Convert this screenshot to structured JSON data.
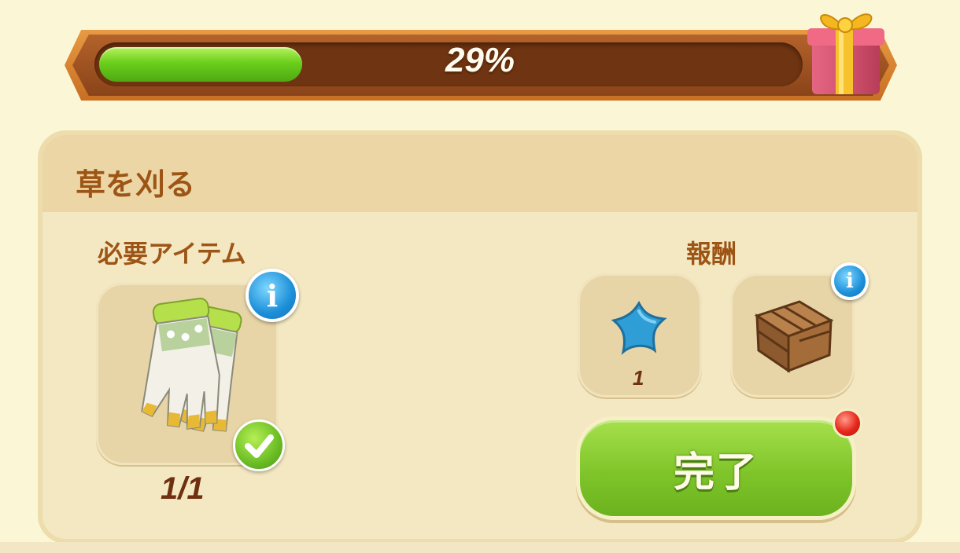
{
  "progress": {
    "percent_label": "29%",
    "fill_fraction": 0.29
  },
  "quest": {
    "title": "草を刈る",
    "required_label": "必要アイテム",
    "reward_label": "報酬",
    "required_item": {
      "icon": "gardening-gloves-icon",
      "count_label": "1/1",
      "completed": true
    },
    "rewards": [
      {
        "icon": "blue-star-icon",
        "count_label": "1"
      },
      {
        "icon": "wooden-crate-icon"
      }
    ],
    "complete_button_label": "完了"
  },
  "colors": {
    "title_brown": "#9d5516",
    "progress_green": "#6bcf1c",
    "button_green": "#7fc52a",
    "info_blue": "#1c8fd8",
    "notification_red": "#e7261b"
  }
}
